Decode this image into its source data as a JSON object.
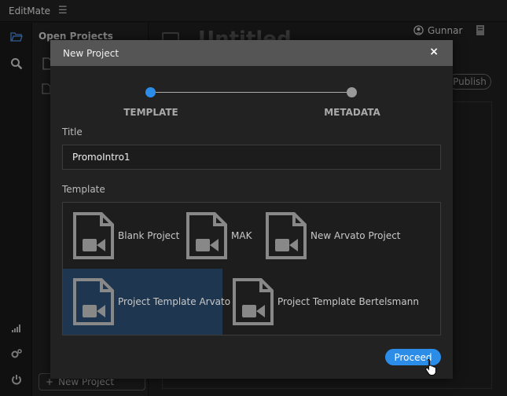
{
  "app": {
    "title": "EditMate",
    "menu_icon": "hamburger-icon"
  },
  "side_panel": {
    "title": "Open Projects",
    "new_project_label": "New Project"
  },
  "main": {
    "doc_title": "Untitled",
    "publish_label": "Publish"
  },
  "user": {
    "name": "Gunnar"
  },
  "modal": {
    "title": "New Project",
    "close_glyph": "×",
    "steps": [
      {
        "label": "TEMPLATE",
        "active": true
      },
      {
        "label": "METADATA",
        "active": false
      }
    ],
    "title_label": "Title",
    "title_value": "PromoIntro1",
    "template_label": "Template",
    "templates": [
      {
        "name": "Blank Project",
        "selected": false
      },
      {
        "name": "MAK",
        "selected": false
      },
      {
        "name": "New Arvato Project",
        "selected": false
      },
      {
        "name": "Project Template Arvato",
        "selected": true
      },
      {
        "name": "Project Template Bertelsmann",
        "selected": false
      }
    ],
    "proceed_label": "Proceed"
  },
  "colors": {
    "accent": "#2b8de8",
    "selected_bg": "#1e3650",
    "header_bg": "#555555"
  }
}
